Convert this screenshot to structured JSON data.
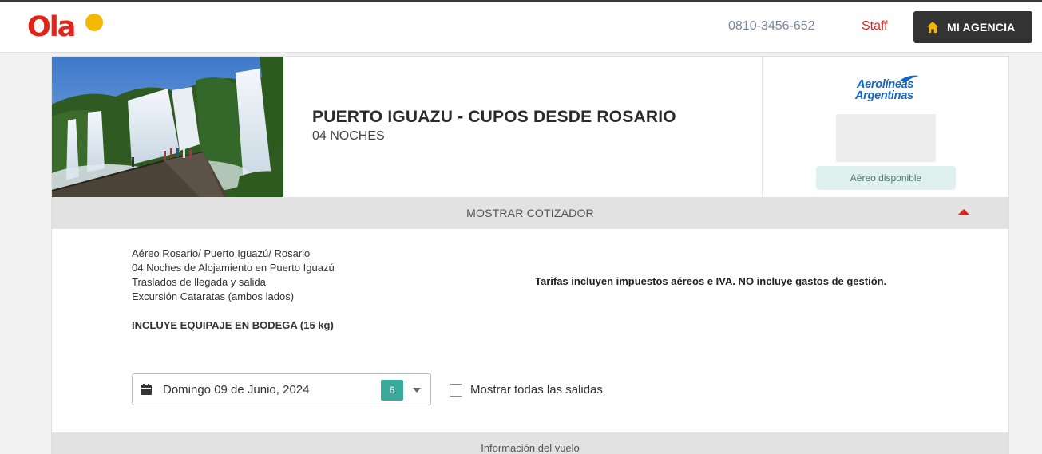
{
  "header": {
    "logo_text": "Ola",
    "phone": "0810-3456-652",
    "staff_label": "Staff",
    "agency_button_label": "MI AGENCIA",
    "brand_color": "#e2231a"
  },
  "package": {
    "title": "PUERTO IGUAZU - CUPOS DESDE ROSARIO",
    "subtitle": "04 NOCHES",
    "image_alt": "Cataratas del Iguazú"
  },
  "airline": {
    "name_line1": "Aerolíneas",
    "name_line2": "Argentinas",
    "badge": "Aéreo disponible"
  },
  "cotizador": {
    "label": "MOSTRAR COTIZADOR"
  },
  "includes": {
    "items": [
      "Aéreo Rosario/ Puerto Iguazú/ Rosario",
      "04 Noches de Alojamiento en Puerto Iguazú",
      "Traslados de llegada y salida",
      "Excursión Cataratas (ambos lados)"
    ],
    "luggage": "INCLUYE EQUIPAJE EN BODEGA (15 kg)"
  },
  "tarifas_note": "Tarifas incluyen impuestos aéreos e IVA. NO incluye gastos de gestión.",
  "departure": {
    "selected_date": "Domingo 09 de Junio, 2024",
    "count": "6",
    "show_all_label": "Mostrar todas las salidas"
  },
  "flight_info": {
    "label": "Información del vuelo"
  }
}
